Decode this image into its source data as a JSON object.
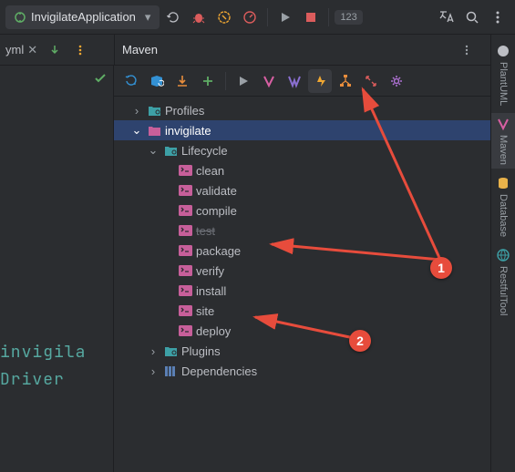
{
  "top": {
    "run_config": "InvigilateApplication",
    "pill": "123"
  },
  "tabs": {
    "file_ext": "yml"
  },
  "panel": {
    "title": "Maven"
  },
  "editor": {
    "line1": "invigila",
    "line2": "Driver"
  },
  "tree": {
    "profiles": "Profiles",
    "project": "invigilate",
    "lifecycle": "Lifecycle",
    "goals": {
      "clean": "clean",
      "validate": "validate",
      "compile": "compile",
      "test": "test",
      "package": "package",
      "verify": "verify",
      "install": "install",
      "site": "site",
      "deploy": "deploy"
    },
    "plugins": "Plugins",
    "dependencies": "Dependencies"
  },
  "rail": {
    "plantuml": "PlantUML",
    "maven": "Maven",
    "database": "Database",
    "restful": "RestfulTool"
  },
  "annotations": {
    "b1": "1",
    "b2": "2"
  },
  "colors": {
    "accent_blue": "#2e436e",
    "folder_pink": "#c75f9a",
    "folder_teal": "#3da0a6",
    "lightning": "#f0a732",
    "violet": "#b072d6"
  }
}
